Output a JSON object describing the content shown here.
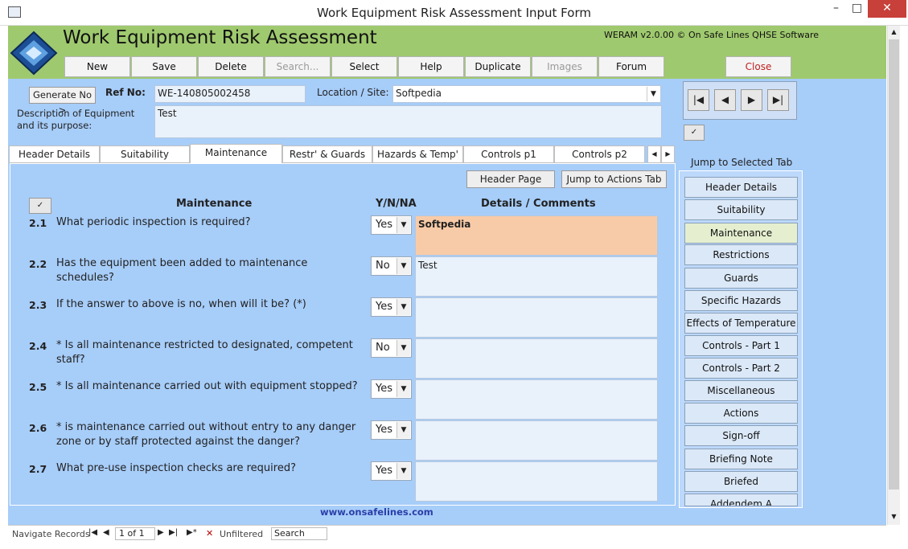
{
  "window": {
    "title": "Work Equipment Risk Assessment Input Form"
  },
  "header": {
    "title": "Work Equipment Risk Assessment",
    "version": "WERAM v2.0.00 © On Safe Lines QHSE Software"
  },
  "toolbar": {
    "new": "New",
    "save": "Save",
    "delete": "Delete",
    "search": "Search...",
    "select": "Select",
    "help": "Help",
    "duplicate": "Duplicate",
    "images": "Images",
    "forum": "Forum",
    "close": "Close"
  },
  "form": {
    "generate_label": "Generate No >",
    "ref_label": "Ref No:",
    "ref_value": "WE-140805002458",
    "location_label": "Location / Site:",
    "location_value": "Softpedia",
    "desc_label": "Description of Equipment and its purpose:",
    "desc_value": "Test"
  },
  "tabs": [
    "Header Details",
    "Suitability",
    "Maintenance",
    "Restr' & Guards",
    "Hazards & Temp'",
    "Controls p1",
    "Controls p2"
  ],
  "panel": {
    "header_page": "Header Page",
    "jump_actions": "Jump to Actions Tab",
    "col_maint": "Maintenance",
    "col_yn": "Y/N/NA",
    "col_details": "Details / Comments",
    "footer_link": "www.onsafelines.com"
  },
  "questions": [
    {
      "num": "2.1",
      "text": "What periodic inspection is required?",
      "answer": "Yes",
      "comment": "Softpedia"
    },
    {
      "num": "2.2",
      "text": "Has the equipment been added to maintenance schedules?",
      "answer": "No",
      "comment": "Test"
    },
    {
      "num": "2.3",
      "text": "If the answer to above is no, when will it be? (*)",
      "answer": "Yes",
      "comment": ""
    },
    {
      "num": "2.4",
      "text": "* Is all maintenance restricted to designated, competent staff?",
      "answer": "No",
      "comment": ""
    },
    {
      "num": "2.5",
      "text": "* Is all maintenance carried out with equipment stopped?",
      "answer": "Yes",
      "comment": ""
    },
    {
      "num": "2.6",
      "text": "* is maintenance carried out without entry to any danger zone or by staff protected against the danger?",
      "answer": "Yes",
      "comment": ""
    },
    {
      "num": "2.7",
      "text": "What pre-use inspection checks are required?",
      "answer": "Yes",
      "comment": ""
    }
  ],
  "right_nav": {
    "title": "Jump to Selected Tab",
    "items": [
      "Header Details",
      "Suitability",
      "Maintenance",
      "Restrictions",
      "Guards",
      "Specific Hazards",
      "Effects of Temperature",
      "Controls - Part 1",
      "Controls - Part 2",
      "Miscellaneous",
      "Actions",
      "Sign-off",
      "Briefing Note",
      "Briefed",
      "Addendem A"
    ]
  },
  "status": {
    "nav_label": "Navigate Records",
    "record": "1 of 1",
    "filter": "Unfiltered",
    "search": "Search"
  },
  "colors": {
    "header_band": "#9fc96e",
    "body": "#a7cdf9",
    "highlight": "#f8cba8",
    "close_btn": "#c7403a"
  }
}
